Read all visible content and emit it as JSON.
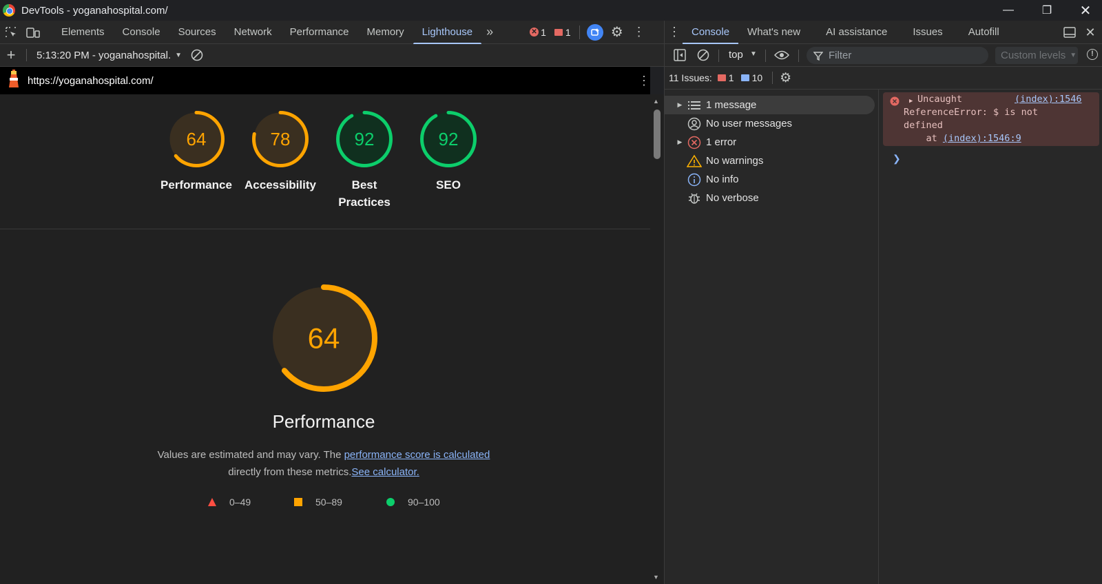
{
  "window": {
    "title": "DevTools - yoganahospital.com/"
  },
  "main_tabs": [
    "Elements",
    "Console",
    "Sources",
    "Network",
    "Performance",
    "Memory",
    "Lighthouse"
  ],
  "active_main_tab": "Lighthouse",
  "badges": {
    "errors": "1",
    "issues": "1"
  },
  "lighthouse": {
    "report_select": "5:13:20 PM - yoganahospital.",
    "url": "https://yoganahospital.com/",
    "gauges": [
      {
        "score": 64,
        "label": "Performance",
        "color": "#ffa400"
      },
      {
        "score": 78,
        "label": "Accessibility",
        "color": "#ffa400"
      },
      {
        "score": 92,
        "label": "Best Practices",
        "color": "#0cce6b"
      },
      {
        "score": 92,
        "label": "SEO",
        "color": "#0cce6b"
      }
    ],
    "main_gauge": {
      "score": 64,
      "title": "Performance",
      "color": "#ffa400"
    },
    "desc_part1": "Values are estimated and may vary. The ",
    "desc_link1": "performance score is calculated",
    "desc_part2": "directly from these metrics.",
    "desc_link2": "See calculator.",
    "legend": [
      {
        "range": "0–49",
        "color": "#ff4e42"
      },
      {
        "range": "50–89",
        "color": "#ffa400"
      },
      {
        "range": "90–100",
        "color": "#0cce6b"
      }
    ]
  },
  "console": {
    "tabs": [
      "Console",
      "What's new",
      "AI assistance",
      "Issues",
      "Autofill"
    ],
    "active_tab": "Console",
    "context": "top",
    "filter_placeholder": "Filter",
    "levels": "Custom levels",
    "issues_label": "11 Issues:",
    "issues_errors": "1",
    "issues_info": "10",
    "sidebar": [
      {
        "label": "1 message",
        "icon": "list-icon",
        "expandable": true
      },
      {
        "label": "No user messages",
        "icon": "user-icon",
        "expandable": false
      },
      {
        "label": "1 error",
        "icon": "error-icon",
        "expandable": true
      },
      {
        "label": "No warnings",
        "icon": "warning-icon",
        "expandable": false
      },
      {
        "label": "No info",
        "icon": "info-icon",
        "expandable": false
      },
      {
        "label": "No verbose",
        "icon": "bug-icon",
        "expandable": false
      }
    ],
    "error": {
      "head": "Uncaught",
      "source": "(index):1546",
      "line2": "ReferenceError: $ is not",
      "line3": "defined",
      "line4_prefix": "    at ",
      "line4_link": "(index):1546:9"
    }
  }
}
